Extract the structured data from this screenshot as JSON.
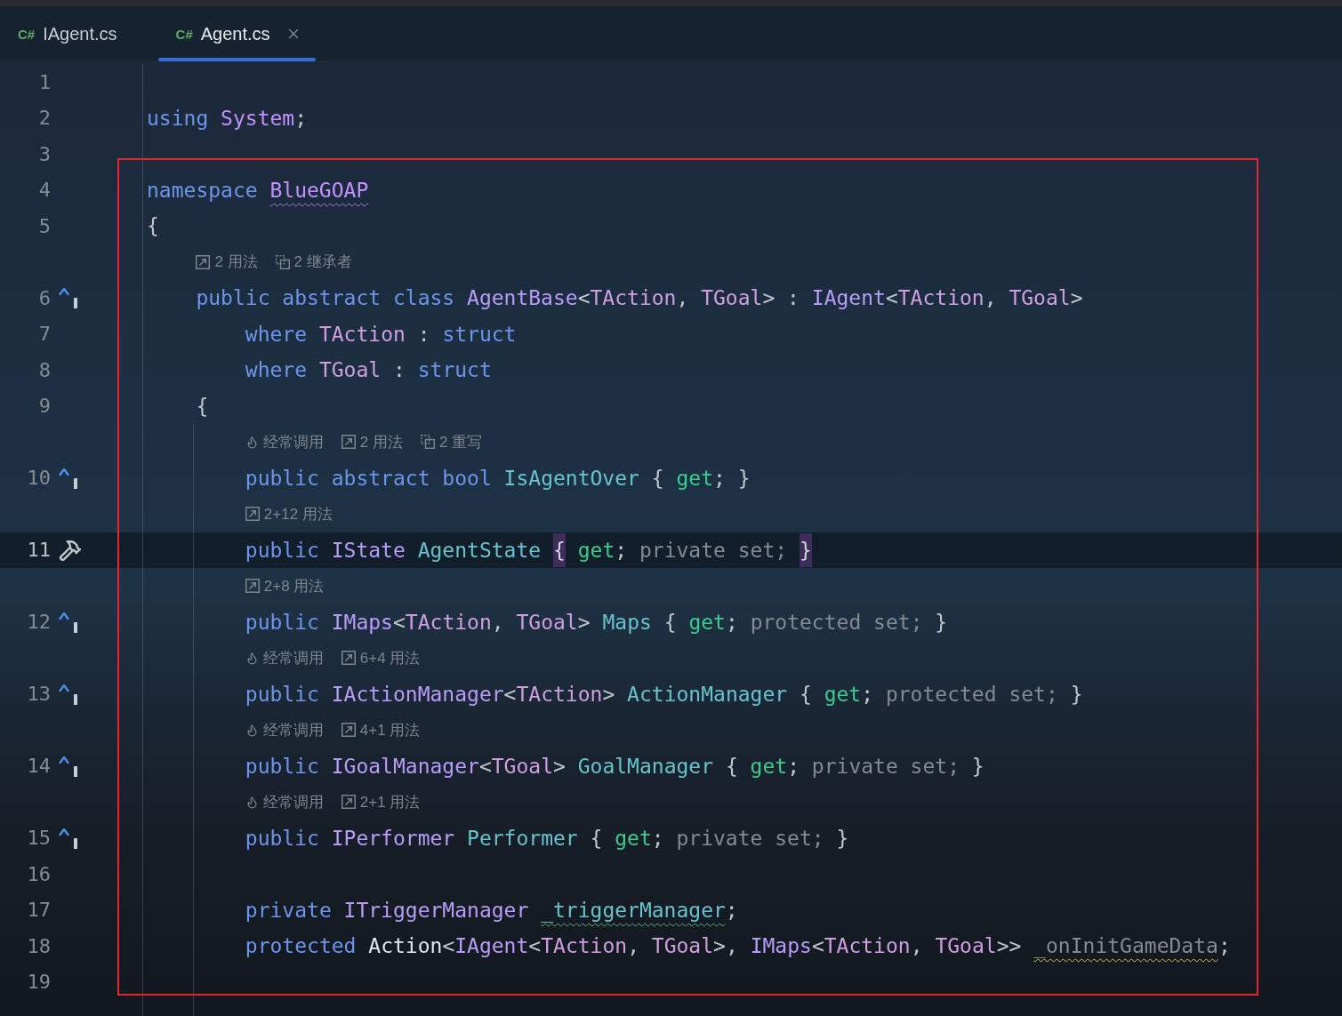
{
  "tabs": [
    {
      "file_type": "C#",
      "label": "IAgent.cs",
      "selected": false
    },
    {
      "file_type": "C#",
      "label": "Agent.cs",
      "selected": true
    }
  ],
  "editor": {
    "lines": [
      {
        "number": "1",
        "current": false
      },
      {
        "number": "2",
        "current": false,
        "tokens": [
          {
            "text": "using ",
            "kind": "keyword"
          },
          {
            "text": "System",
            "kind": "namespace"
          },
          {
            "text": ";",
            "kind": "plain"
          }
        ]
      },
      {
        "number": "3",
        "current": false
      },
      {
        "number": "4",
        "current": false,
        "tokens": [
          {
            "text": "namespace ",
            "kind": "keyword"
          },
          {
            "text": "BlueGOAP",
            "kind": "namespace",
            "squiggle": {
              "kind": "hint"
            }
          }
        ]
      },
      {
        "number": "5",
        "current": false,
        "tokens": [
          {
            "text": "{",
            "kind": "plain"
          }
        ],
        "children": [
          {
            "number": "6",
            "current": false,
            "marker": {
              "kind": "implements"
            },
            "hints": [
              {
                "kind": "usages",
                "text": "2 用法"
              },
              {
                "kind": "hierarchy",
                "text": "2 继承者"
              }
            ],
            "tokens": [
              {
                "text": "public abstract class ",
                "kind": "keyword"
              },
              {
                "text": "AgentBase",
                "kind": "type"
              },
              {
                "text": "<",
                "kind": "plain"
              },
              {
                "text": "TAction",
                "kind": "type-param"
              },
              {
                "text": ", ",
                "kind": "plain"
              },
              {
                "text": "TGoal",
                "kind": "type-param"
              },
              {
                "text": "> : ",
                "kind": "plain"
              },
              {
                "text": "IAgent",
                "kind": "type"
              },
              {
                "text": "<",
                "kind": "plain"
              },
              {
                "text": "TAction",
                "kind": "type-param"
              },
              {
                "text": ", ",
                "kind": "plain"
              },
              {
                "text": "TGoal",
                "kind": "type-param"
              },
              {
                "text": ">",
                "kind": "plain"
              }
            ],
            "children": [
              {
                "number": "7",
                "current": false,
                "tokens": [
                  {
                    "text": "where ",
                    "kind": "keyword"
                  },
                  {
                    "text": "TAction",
                    "kind": "type-param"
                  },
                  {
                    "text": " : ",
                    "kind": "plain"
                  },
                  {
                    "text": "struct",
                    "kind": "keyword"
                  }
                ]
              },
              {
                "number": "8",
                "current": false,
                "tokens": [
                  {
                    "text": "where ",
                    "kind": "keyword"
                  },
                  {
                    "text": "TGoal",
                    "kind": "type-param"
                  },
                  {
                    "text": " : ",
                    "kind": "plain"
                  },
                  {
                    "text": "struct",
                    "kind": "keyword"
                  }
                ]
              }
            ]
          },
          {
            "number": "9",
            "current": false,
            "indent_guide": true,
            "tokens": [
              {
                "text": "{",
                "kind": "plain"
              }
            ],
            "children": [
              {
                "number": "10",
                "current": false,
                "marker": {
                  "kind": "implements"
                },
                "hints": [
                  {
                    "kind": "frequent",
                    "text": "经常调用"
                  },
                  {
                    "kind": "usages",
                    "text": "2 用法"
                  },
                  {
                    "kind": "hierarchy",
                    "text": "2 重写"
                  }
                ],
                "tokens": [
                  {
                    "text": "public abstract bool ",
                    "kind": "keyword"
                  },
                  {
                    "text": "IsAgentOver",
                    "kind": "property"
                  },
                  {
                    "text": " { ",
                    "kind": "plain"
                  },
                  {
                    "text": "get",
                    "kind": "accessor"
                  },
                  {
                    "text": "; }",
                    "kind": "plain"
                  }
                ]
              },
              {
                "number": "11",
                "current": true,
                "marker": {
                  "kind": "hammer"
                },
                "hints": [
                  {
                    "kind": "usages",
                    "text": "2+12 用法"
                  }
                ],
                "tokens": [
                  {
                    "text": "public ",
                    "kind": "keyword"
                  },
                  {
                    "text": "IState ",
                    "kind": "type"
                  },
                  {
                    "text": "AgentState ",
                    "kind": "property"
                  },
                  {
                    "text": "{",
                    "kind": "matched-brace"
                  },
                  {
                    "text": " get",
                    "kind": "accessor"
                  },
                  {
                    "text": "; ",
                    "kind": "plain"
                  },
                  {
                    "text": "private set; ",
                    "kind": "muted"
                  },
                  {
                    "text": "}",
                    "kind": "matched-brace"
                  }
                ]
              },
              {
                "number": "12",
                "current": false,
                "marker": {
                  "kind": "implements"
                },
                "hints": [
                  {
                    "kind": "usages",
                    "text": "2+8 用法"
                  }
                ],
                "tokens": [
                  {
                    "text": "public ",
                    "kind": "keyword"
                  },
                  {
                    "text": "IMaps",
                    "kind": "type"
                  },
                  {
                    "text": "<",
                    "kind": "plain"
                  },
                  {
                    "text": "TAction",
                    "kind": "type-param"
                  },
                  {
                    "text": ", ",
                    "kind": "plain"
                  },
                  {
                    "text": "TGoal",
                    "kind": "type-param"
                  },
                  {
                    "text": "> ",
                    "kind": "plain"
                  },
                  {
                    "text": "Maps",
                    "kind": "property"
                  },
                  {
                    "text": " { ",
                    "kind": "plain"
                  },
                  {
                    "text": "get",
                    "kind": "accessor"
                  },
                  {
                    "text": "; ",
                    "kind": "plain"
                  },
                  {
                    "text": "protected set;",
                    "kind": "muted"
                  },
                  {
                    "text": " }",
                    "kind": "plain"
                  }
                ]
              },
              {
                "number": "13",
                "current": false,
                "marker": {
                  "kind": "implements"
                },
                "hints": [
                  {
                    "kind": "frequent",
                    "text": "经常调用"
                  },
                  {
                    "kind": "usages",
                    "text": "6+4 用法"
                  }
                ],
                "tokens": [
                  {
                    "text": "public ",
                    "kind": "keyword"
                  },
                  {
                    "text": "IActionManager",
                    "kind": "type"
                  },
                  {
                    "text": "<",
                    "kind": "plain"
                  },
                  {
                    "text": "TAction",
                    "kind": "type-param"
                  },
                  {
                    "text": "> ",
                    "kind": "plain"
                  },
                  {
                    "text": "ActionManager",
                    "kind": "property"
                  },
                  {
                    "text": " { ",
                    "kind": "plain"
                  },
                  {
                    "text": "get",
                    "kind": "accessor"
                  },
                  {
                    "text": "; ",
                    "kind": "plain"
                  },
                  {
                    "text": "protected set;",
                    "kind": "muted"
                  },
                  {
                    "text": " }",
                    "kind": "plain"
                  }
                ]
              },
              {
                "number": "14",
                "current": false,
                "marker": {
                  "kind": "implements"
                },
                "hints": [
                  {
                    "kind": "frequent",
                    "text": "经常调用"
                  },
                  {
                    "kind": "usages",
                    "text": "4+1 用法"
                  }
                ],
                "tokens": [
                  {
                    "text": "public ",
                    "kind": "keyword"
                  },
                  {
                    "text": "IGoalManager",
                    "kind": "type"
                  },
                  {
                    "text": "<",
                    "kind": "plain"
                  },
                  {
                    "text": "TGoal",
                    "kind": "type-param"
                  },
                  {
                    "text": "> ",
                    "kind": "plain"
                  },
                  {
                    "text": "GoalManager",
                    "kind": "property"
                  },
                  {
                    "text": " { ",
                    "kind": "plain"
                  },
                  {
                    "text": "get",
                    "kind": "accessor"
                  },
                  {
                    "text": "; ",
                    "kind": "plain"
                  },
                  {
                    "text": "private set;",
                    "kind": "muted"
                  },
                  {
                    "text": " }",
                    "kind": "plain"
                  }
                ]
              },
              {
                "number": "15",
                "current": false,
                "marker": {
                  "kind": "implements"
                },
                "hints": [
                  {
                    "kind": "frequent",
                    "text": "经常调用"
                  },
                  {
                    "kind": "usages",
                    "text": "2+1 用法"
                  }
                ],
                "tokens": [
                  {
                    "text": "public ",
                    "kind": "keyword"
                  },
                  {
                    "text": "IPerformer ",
                    "kind": "type"
                  },
                  {
                    "text": "Performer",
                    "kind": "property"
                  },
                  {
                    "text": " { ",
                    "kind": "plain"
                  },
                  {
                    "text": "get",
                    "kind": "accessor"
                  },
                  {
                    "text": "; ",
                    "kind": "plain"
                  },
                  {
                    "text": "private set;",
                    "kind": "muted"
                  },
                  {
                    "text": " }",
                    "kind": "plain"
                  }
                ]
              },
              {
                "number": "16",
                "current": false
              },
              {
                "number": "17",
                "current": false,
                "tokens": [
                  {
                    "text": "private ",
                    "kind": "keyword"
                  },
                  {
                    "text": "ITriggerManager ",
                    "kind": "type"
                  },
                  {
                    "text": "_triggerManager",
                    "kind": "field",
                    "squiggle": {
                      "kind": "typo"
                    }
                  },
                  {
                    "text": ";",
                    "kind": "plain"
                  }
                ]
              },
              {
                "number": "18",
                "current": false,
                "tokens": [
                  {
                    "text": "protected ",
                    "kind": "keyword"
                  },
                  {
                    "text": "Action",
                    "kind": "delegate"
                  },
                  {
                    "text": "<",
                    "kind": "plain"
                  },
                  {
                    "text": "IAgent",
                    "kind": "type"
                  },
                  {
                    "text": "<",
                    "kind": "plain"
                  },
                  {
                    "text": "TAction",
                    "kind": "type-param"
                  },
                  {
                    "text": ", ",
                    "kind": "plain"
                  },
                  {
                    "text": "TGoal",
                    "kind": "type-param"
                  },
                  {
                    "text": ">, ",
                    "kind": "plain"
                  },
                  {
                    "text": "IMaps",
                    "kind": "type"
                  },
                  {
                    "text": "<",
                    "kind": "plain"
                  },
                  {
                    "text": "TAction",
                    "kind": "type-param"
                  },
                  {
                    "text": ", ",
                    "kind": "plain"
                  },
                  {
                    "text": "TGoal",
                    "kind": "type-param"
                  },
                  {
                    "text": ">> ",
                    "kind": "plain"
                  },
                  {
                    "text": "_onInitGameData",
                    "kind": "unused",
                    "squiggle": {
                      "kind": "warning"
                    }
                  },
                  {
                    "text": ";",
                    "kind": "plain"
                  }
                ]
              },
              {
                "number": "19",
                "current": false
              }
            ]
          }
        ]
      }
    ]
  }
}
